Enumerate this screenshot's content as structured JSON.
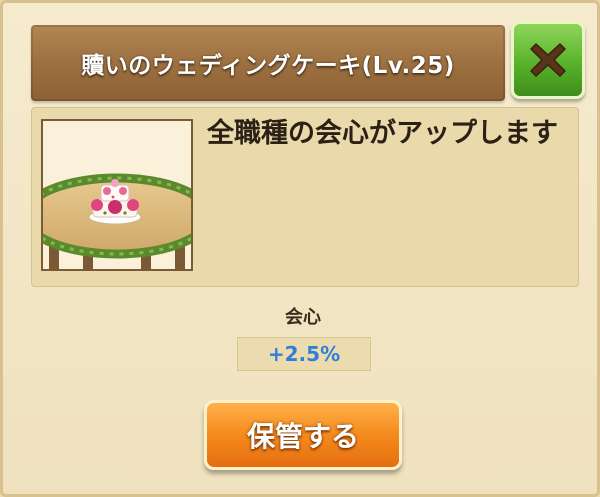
{
  "dialog": {
    "title": "贖いのウェディングケーキ(Lv.25)",
    "close_icon": "x-icon",
    "item": {
      "icon": "wedding-cake-icon",
      "description": "全職種の会心がアップします"
    },
    "stat": {
      "label": "会心",
      "value": "+2.5%"
    },
    "store_button_label": "保管する"
  },
  "colors": {
    "title_bar": "#9d7040",
    "close_button": "#59b22b",
    "store_button": "#f48b1d",
    "stat_value": "#2f7fd8"
  }
}
